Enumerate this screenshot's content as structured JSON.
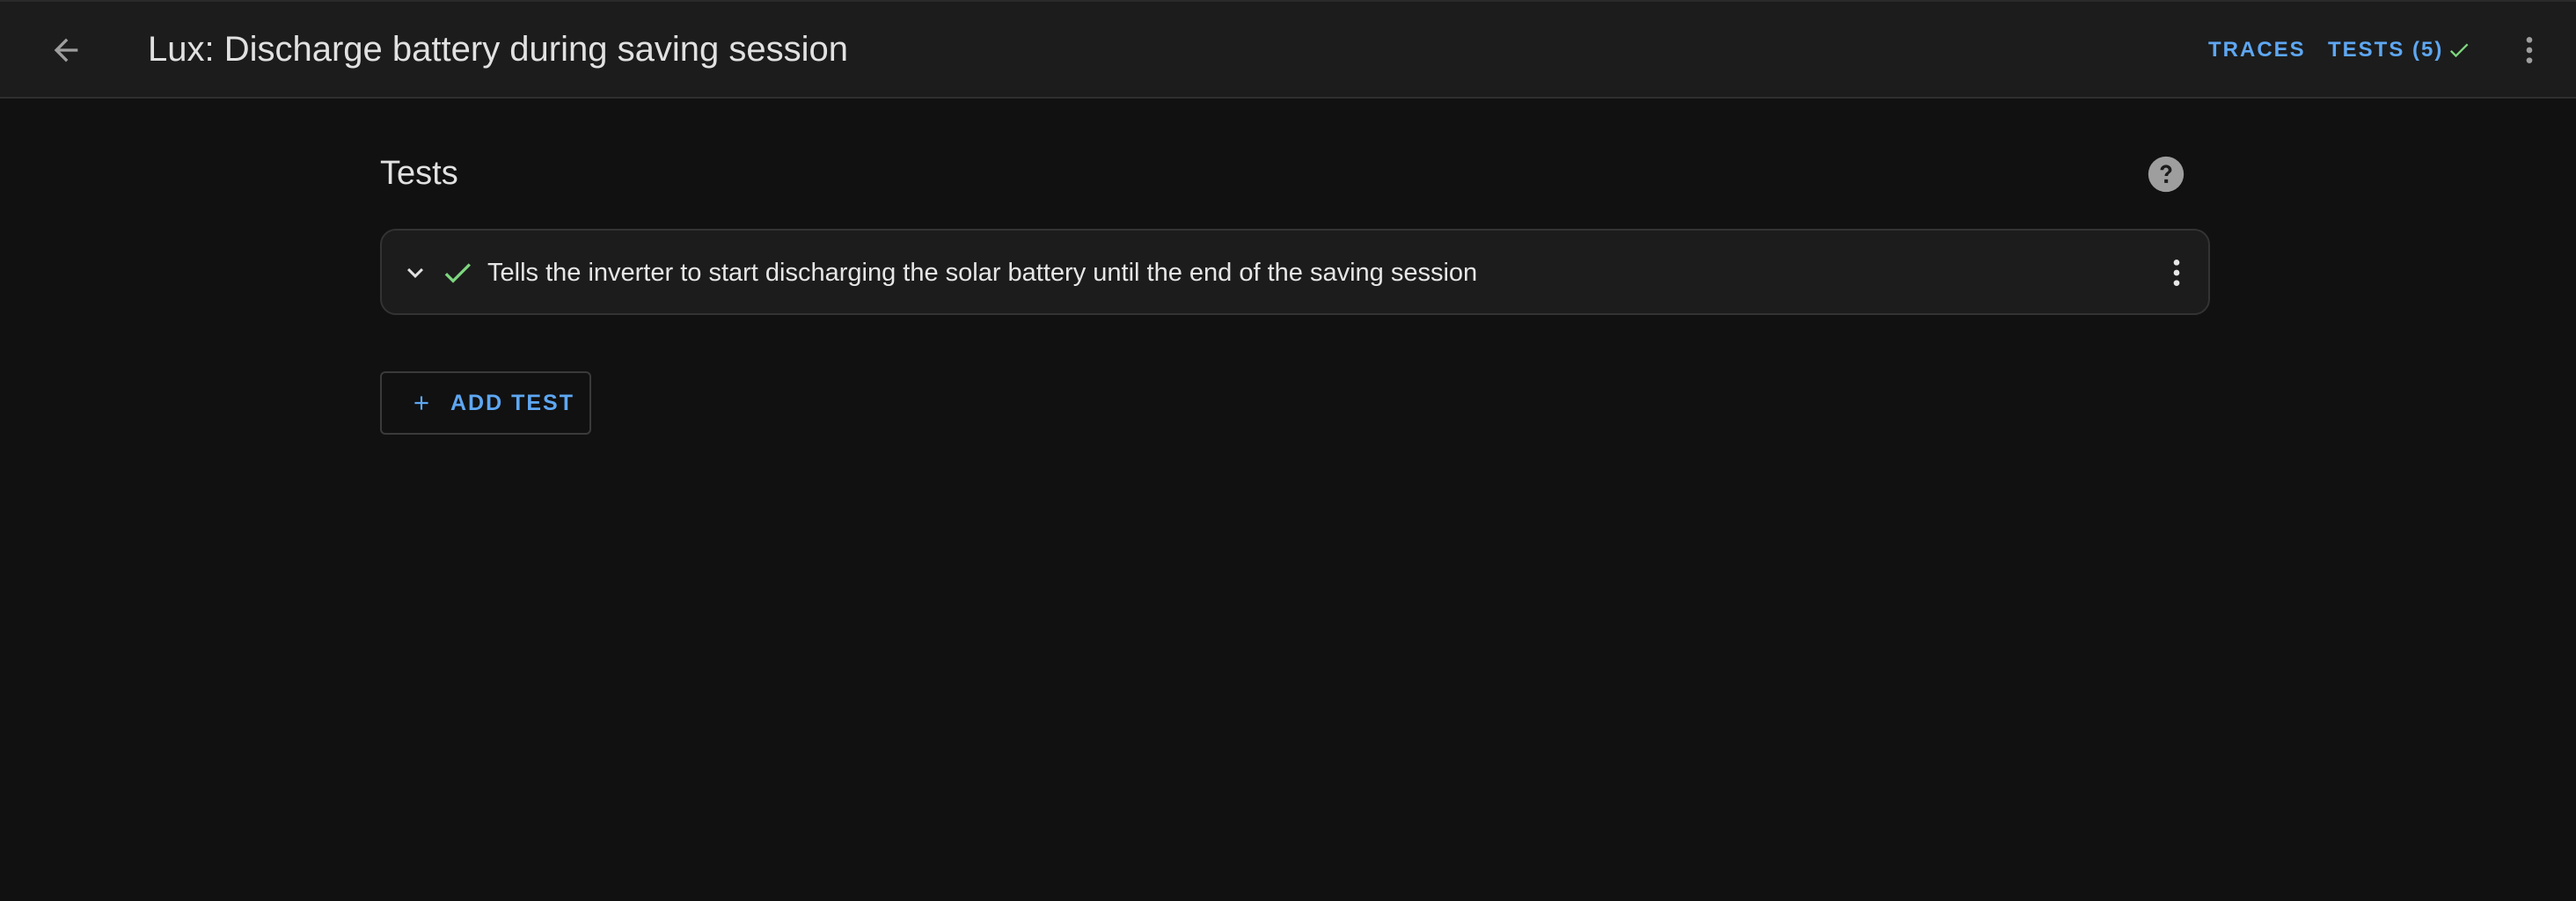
{
  "header": {
    "title": "Lux: Discharge battery during saving session",
    "traces_label": "TRACES",
    "tests_label": "TESTS (5)",
    "back_icon": "arrow-left-icon",
    "menu_icon": "dots-vertical-icon",
    "tests_status_icon": "check-icon"
  },
  "tests_section": {
    "title": "Tests",
    "help_icon": "help-circle-icon",
    "items": [
      {
        "description": "Tells the inverter to start discharging the solar battery until the end of the saving session",
        "status": "passed",
        "status_icon": "check-icon"
      }
    ],
    "add_label": "ADD TEST"
  },
  "colors": {
    "background": "#111111",
    "header_bg": "#1c1c1c",
    "accent": "#5ea7f2",
    "success": "#7ed67e",
    "text": "#e1e1e1"
  }
}
